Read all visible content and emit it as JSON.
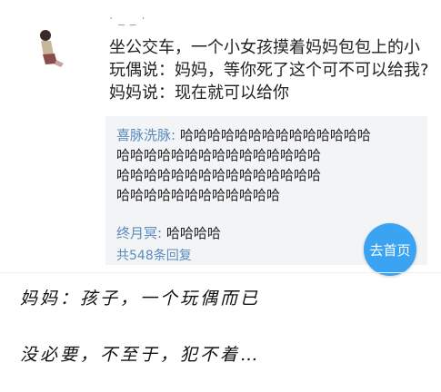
{
  "post": {
    "username": "· _ _ ·",
    "lines": [
      "坐公交车，一个小女孩摸着妈妈包包上的小",
      "玩偶说：妈妈，等你死了这个可不可以给我?",
      "妈妈说：现在就可以给你"
    ]
  },
  "comments": {
    "first": {
      "user": "喜脉洗脉:",
      "lines": [
        " 哈哈哈哈哈哈哈哈哈哈哈哈哈哈",
        "哈哈哈哈哈哈哈哈哈哈哈哈哈哈哈",
        "哈哈哈哈哈哈哈哈哈哈哈哈哈哈哈",
        "哈哈哈哈哈哈哈哈哈哈哈哈"
      ]
    },
    "second": {
      "user": "终月冥:",
      "text": " 哈哈哈哈"
    },
    "reply_count": "共548条回复"
  },
  "home_button": {
    "label": "去首页"
  },
  "handwritten": {
    "line1": "妈妈：孩子，一个玩偶而已",
    "line2": "没必要，不至于，犯不着…"
  }
}
